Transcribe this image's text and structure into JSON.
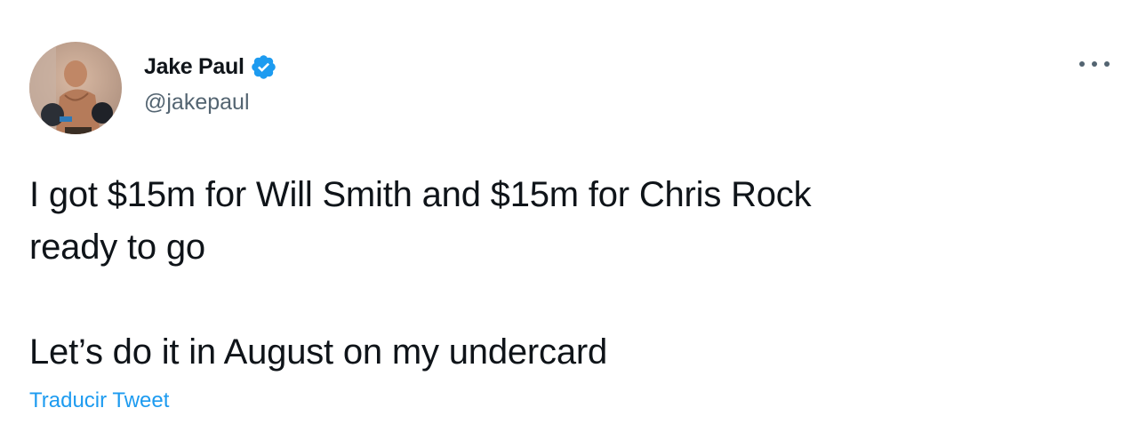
{
  "tweet": {
    "author": {
      "display_name": "Jake Paul",
      "handle": "@jakepaul",
      "verified": true,
      "avatar_icon": "boxer-photo-avatar"
    },
    "text_lines": [
      "I got $15m for Will Smith and $15m for Chris Rock",
      "ready to go",
      "",
      "Let’s do it in August on my undercard"
    ],
    "translate_label": "Traducir Tweet",
    "more_icon": "more-horizontal-icon"
  },
  "colors": {
    "text_primary": "#0f1419",
    "text_secondary": "#536471",
    "accent": "#1d9bf0"
  }
}
